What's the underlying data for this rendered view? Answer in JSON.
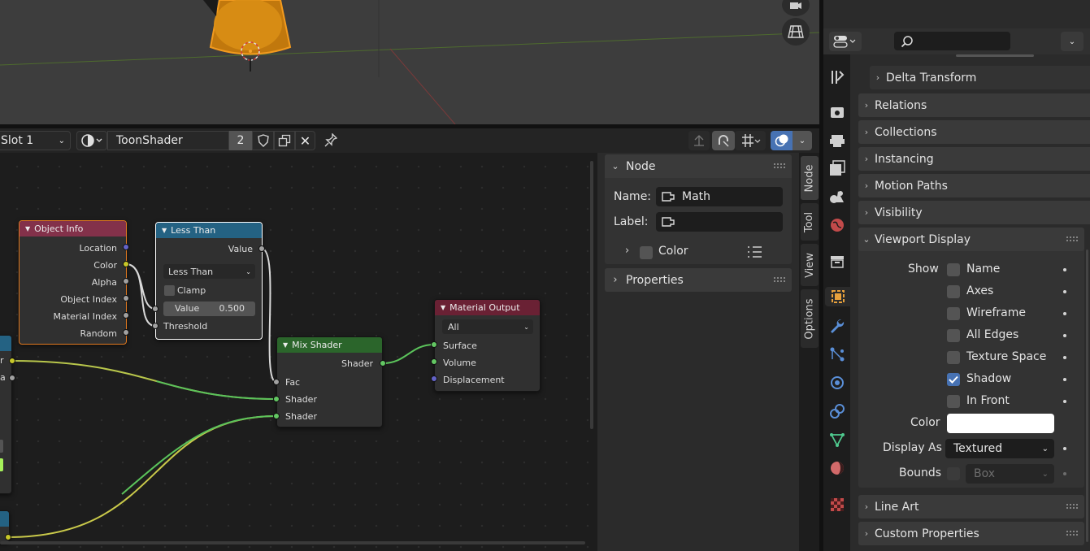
{
  "header": {
    "slot": "Slot 1",
    "material_name": "ToonShader",
    "user_count": "2"
  },
  "nodes": {
    "object_info": {
      "title": "Object Info",
      "outputs": [
        "Location",
        "Color",
        "Alpha",
        "Object Index",
        "Material Index",
        "Random"
      ]
    },
    "less_than": {
      "title": "Less Than",
      "output": "Value",
      "operation": "Less Than",
      "clamp": "Clamp",
      "value_label": "Value",
      "value": "0.500",
      "threshold": "Threshold"
    },
    "mix_shader": {
      "title": "Mix Shader",
      "output": "Shader",
      "inputs": [
        "Fac",
        "Shader",
        "Shader"
      ]
    },
    "material_output": {
      "title": "Material Output",
      "target": "All",
      "inputs": [
        "Surface",
        "Volume",
        "Displacement"
      ]
    },
    "left_partial": {
      "out1": "r",
      "out2": "a"
    }
  },
  "npanel": {
    "node_header": "Node",
    "name_label": "Name:",
    "name_value": "Math",
    "label_label": "Label:",
    "label_value": "",
    "color_label": "Color",
    "properties_label": "Properties",
    "tabs": [
      "Node",
      "Tool",
      "View",
      "Options"
    ]
  },
  "properties": {
    "search_placeholder": "",
    "panels_top": [
      "Delta Transform",
      "Relations",
      "Collections",
      "Instancing",
      "Motion Paths",
      "Visibility"
    ],
    "viewport_display": {
      "title": "Viewport Display",
      "show_label": "Show",
      "options": [
        {
          "label": "Name",
          "checked": false
        },
        {
          "label": "Axes",
          "checked": false
        },
        {
          "label": "Wireframe",
          "checked": false
        },
        {
          "label": "All Edges",
          "checked": false
        },
        {
          "label": "Texture Space",
          "checked": false
        },
        {
          "label": "Shadow",
          "checked": true
        },
        {
          "label": "In Front",
          "checked": false
        }
      ],
      "color_label": "Color",
      "color_value": "#ffffff",
      "display_as_label": "Display As",
      "display_as_value": "Textured",
      "bounds_label": "Bounds",
      "bounds_value": "Box"
    },
    "panels_bottom": [
      "Line Art",
      "Custom Properties"
    ]
  },
  "colors": {
    "accent": "#4772b3",
    "object_info_header": "#83314a",
    "less_than_header": "#246283",
    "mix_shader_header": "#2b652b",
    "material_output_header": "#6a2134",
    "selected_outline": "#e0791f"
  }
}
